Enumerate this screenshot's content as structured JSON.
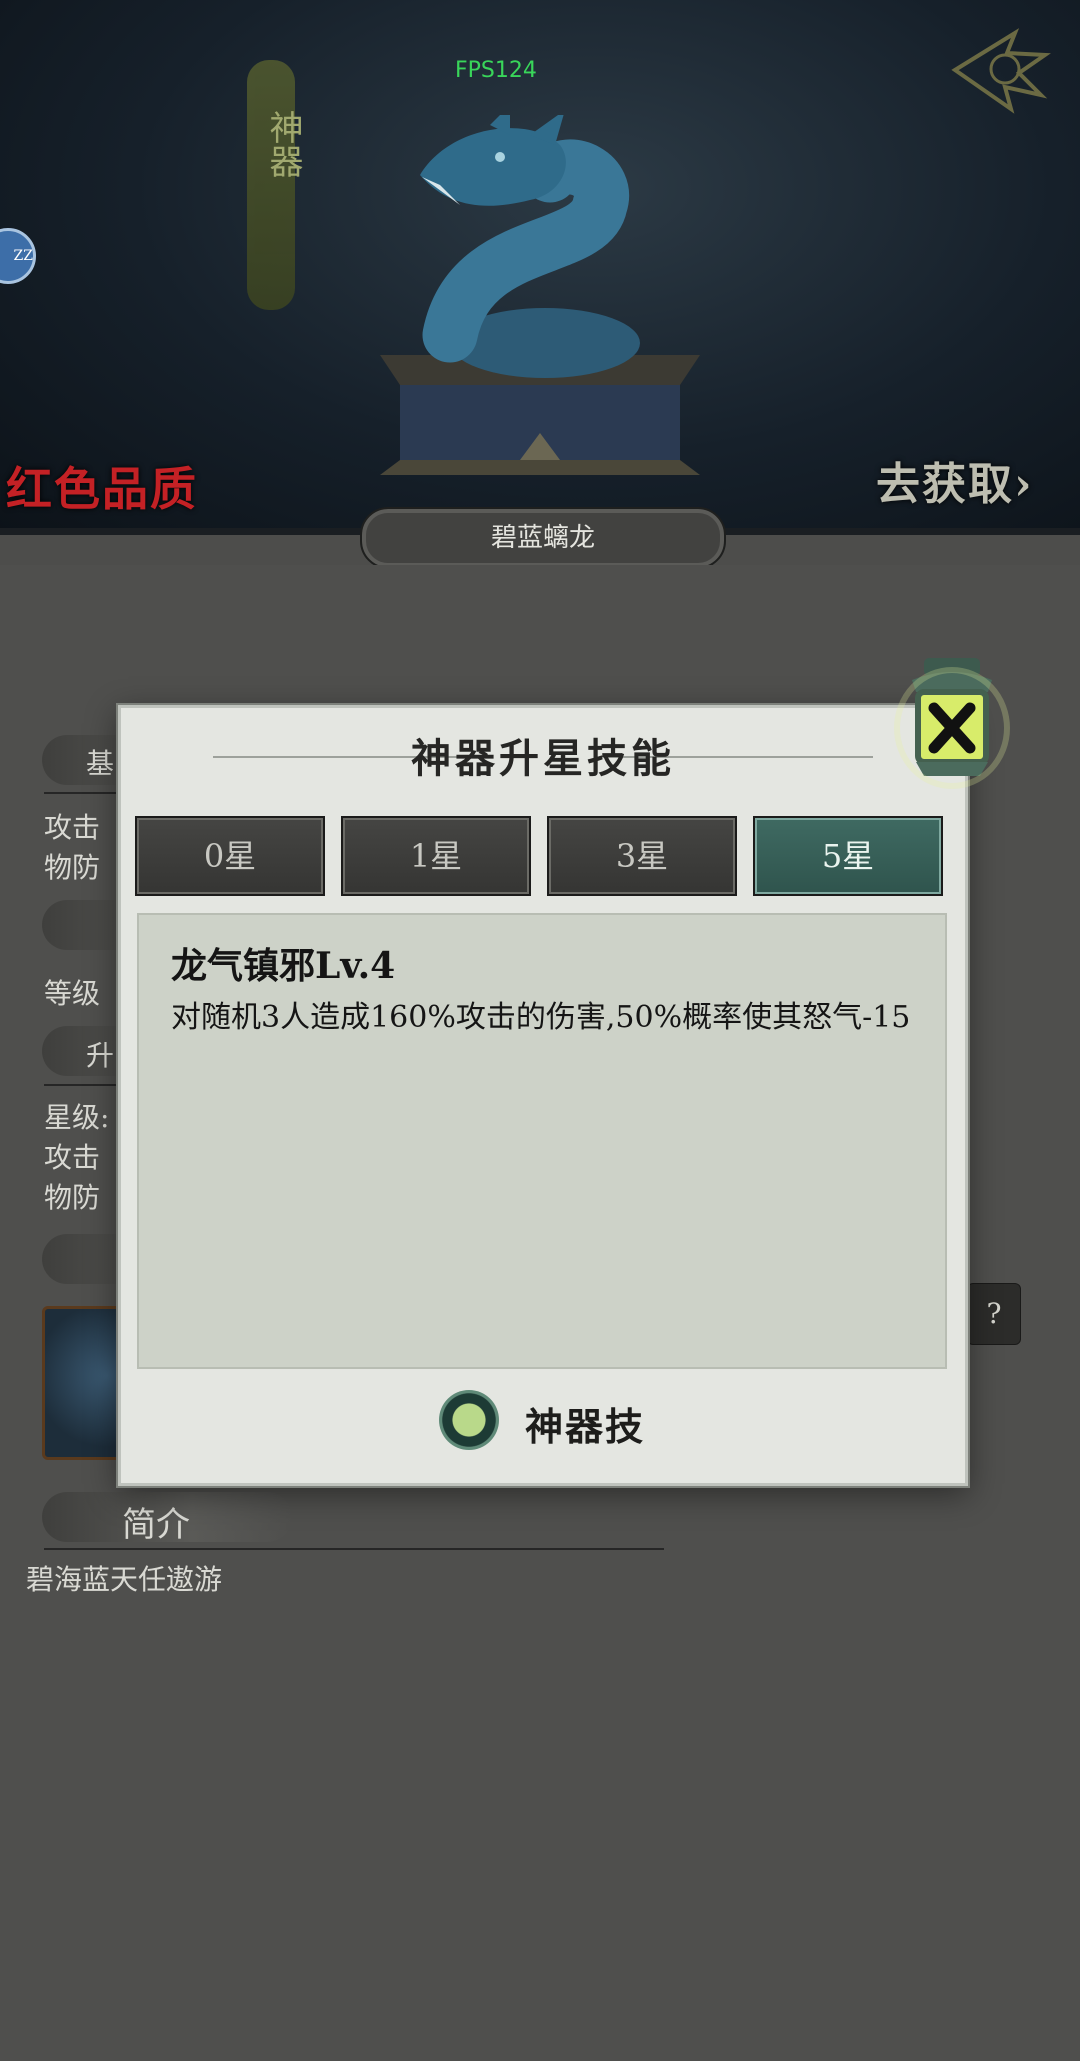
{
  "overlay": {
    "fps": "FPS124"
  },
  "banner": {
    "category_vertical": "神器",
    "left_bubble": "ZZ",
    "quality": "红色品质",
    "get_link": "去获取",
    "get_arrow": "›",
    "artifact_name": "碧蓝螭龙"
  },
  "background_page": {
    "section_basic_fragment": "基",
    "row1": [
      "攻击",
      "物防"
    ],
    "level_label": "等级",
    "section_upgrade_fragment": "升",
    "row2": [
      "星级:",
      "攻击",
      "物防"
    ],
    "help_icon": "?",
    "intro_header": "简介",
    "intro_text": "碧海蓝天任遨游"
  },
  "modal": {
    "title": "神器升星技能",
    "tabs": [
      {
        "label": "0星",
        "active": false
      },
      {
        "label": "1星",
        "active": false
      },
      {
        "label": "3星",
        "active": false
      },
      {
        "label": "5星",
        "active": true
      }
    ],
    "skill_name": "龙气镇邪Lv.4",
    "skill_desc": "对随机3人造成160%攻击的伤害,50%概率使其怒气-15",
    "skill_type_label": "神器技"
  },
  "colors": {
    "active_tab": "#2f544d",
    "quality_red": "#c42125",
    "fps_green": "#39d65a"
  }
}
